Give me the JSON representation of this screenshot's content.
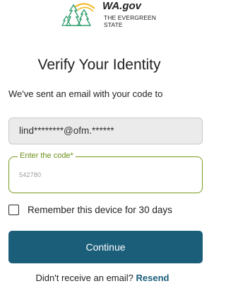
{
  "logo": {
    "icon": "evergreen-trees-logo",
    "title": "WA.gov",
    "subtitle_line1": "THE EVERGREEN",
    "subtitle_line2": "STATE",
    "colors": {
      "trees": "#2e9e6d",
      "swoosh": "#f2b824"
    }
  },
  "header": {
    "title": "Verify Your Identity",
    "subtitle": "We've sent an email with your code to"
  },
  "email_field": {
    "value": "lind********@ofm.******"
  },
  "code_field": {
    "label": "Enter the code*",
    "value": "542780"
  },
  "remember": {
    "label": "Remember this device for 30 days",
    "checked": false
  },
  "continue_button": {
    "label": "Continue",
    "color": "#1b5e7a"
  },
  "resend": {
    "prompt": "Didn't receive an email?",
    "link_label": "Resend"
  }
}
